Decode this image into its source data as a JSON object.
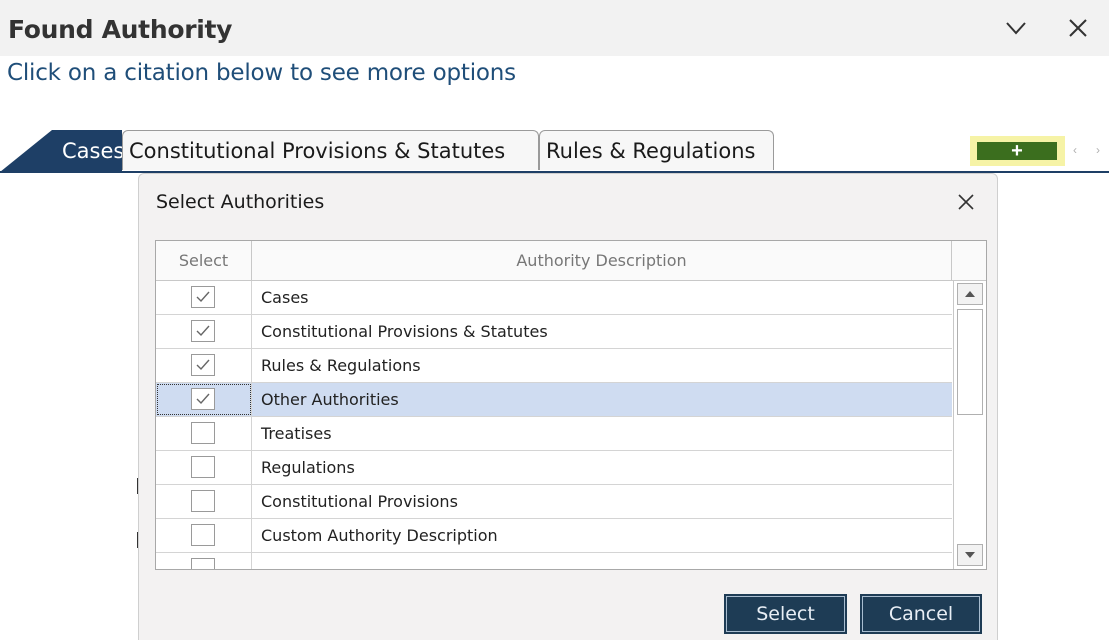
{
  "panel": {
    "title": "Found Authority",
    "subtitle": "Click on a citation below to see more options",
    "collapse_icon": "chevron-down-icon",
    "close_icon": "close-icon"
  },
  "tabs": {
    "active": "Cases",
    "items": [
      "Constitutional Provisions & Statutes",
      "Rules & Regulations"
    ],
    "add_label": "+",
    "scroll_left_icon": "chevron-left-icon",
    "scroll_right_icon": "chevron-right-icon"
  },
  "dialog": {
    "title": "Select Authorities",
    "close_icon": "close-icon",
    "columns": {
      "select": "Select",
      "description": "Authority Description"
    },
    "rows": [
      {
        "checked": true,
        "description": "Cases",
        "selected": false
      },
      {
        "checked": true,
        "description": "Constitutional Provisions & Statutes",
        "selected": false
      },
      {
        "checked": true,
        "description": "Rules & Regulations",
        "selected": false
      },
      {
        "checked": true,
        "description": "Other Authorities",
        "selected": true
      },
      {
        "checked": false,
        "description": "Treatises",
        "selected": false
      },
      {
        "checked": false,
        "description": "Regulations",
        "selected": false
      },
      {
        "checked": false,
        "description": "Constitutional Provisions",
        "selected": false
      },
      {
        "checked": false,
        "description": "Custom Authority Description",
        "selected": false
      },
      {
        "checked": false,
        "description": "",
        "selected": false
      }
    ],
    "select_button": "Select",
    "cancel_button": "Cancel"
  },
  "colors": {
    "accent_navy": "#1e3f66",
    "add_button_green": "#3b6e1e",
    "add_button_highlight": "#f6f3a6",
    "row_selected": "#cfdcf1",
    "subtitle_blue": "#1f4e79"
  }
}
